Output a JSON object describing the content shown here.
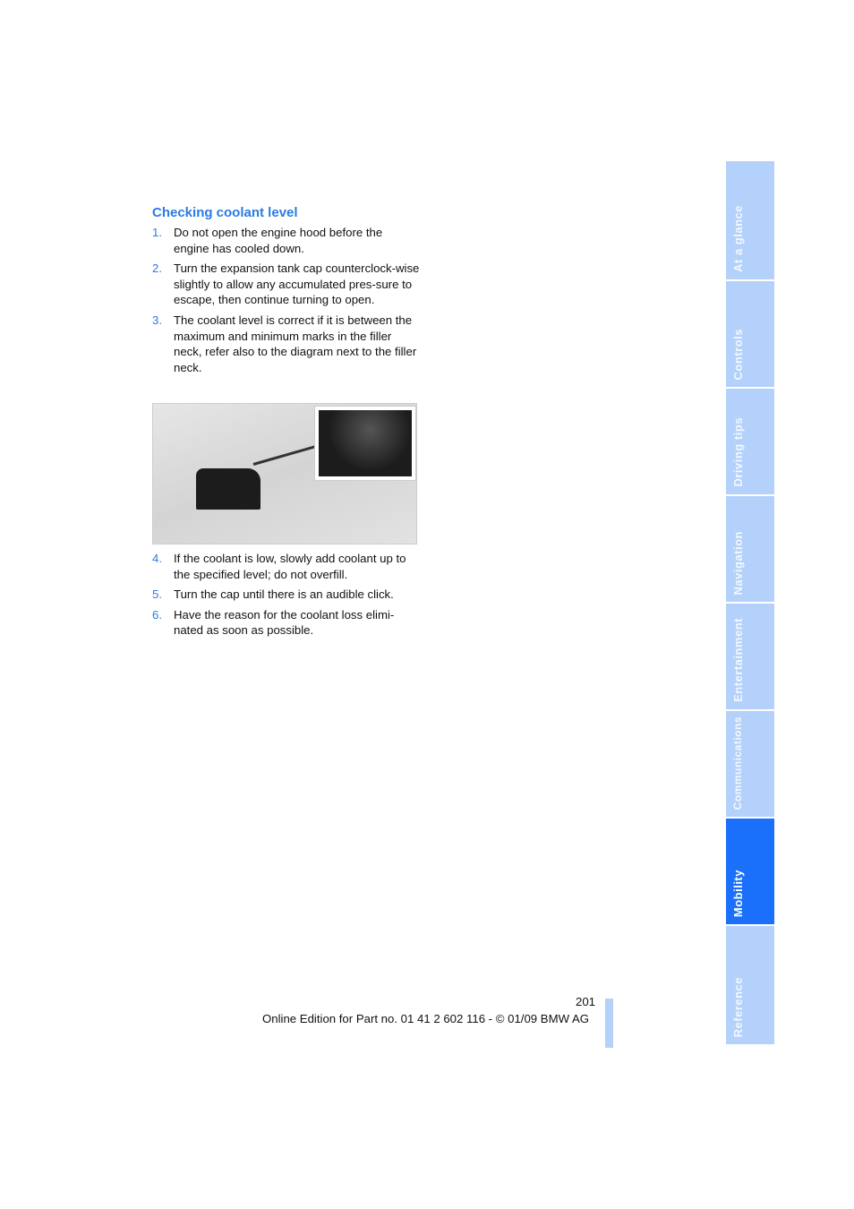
{
  "heading": "Checking coolant level",
  "steps_a": [
    {
      "n": "1.",
      "text": "Do not open the engine hood before the engine has cooled down."
    },
    {
      "n": "2.",
      "text": "Turn the expansion tank cap counterclock-wise slightly to allow any accumulated pres-sure to escape, then continue turning to open."
    },
    {
      "n": "3.",
      "text": "The coolant level is correct if it is between the maximum and minimum marks in the filler neck, refer also to the diagram next to the filler neck."
    }
  ],
  "steps_b": [
    {
      "n": "4.",
      "text": "If the coolant is low, slowly add coolant up to the specified level; do not overfill."
    },
    {
      "n": "5.",
      "text": "Turn the cap until there is an audible click."
    },
    {
      "n": "6.",
      "text": "Have the reason for the coolant loss elimi-nated as soon as possible."
    }
  ],
  "page_number": "201",
  "footer": "Online Edition for Part no. 01 41 2 602 116 - © 01/09 BMW AG",
  "tabs": [
    {
      "label": "At a glance"
    },
    {
      "label": "Controls"
    },
    {
      "label": "Driving tips"
    },
    {
      "label": "Navigation"
    },
    {
      "label": "Entertainment"
    },
    {
      "label": "Communications"
    },
    {
      "label": "Mobility",
      "active": true
    },
    {
      "label": "Reference"
    }
  ],
  "colors": {
    "accent": "#2a7be4",
    "tab": "#b3d1fb",
    "tab_active": "#1a70fa"
  }
}
